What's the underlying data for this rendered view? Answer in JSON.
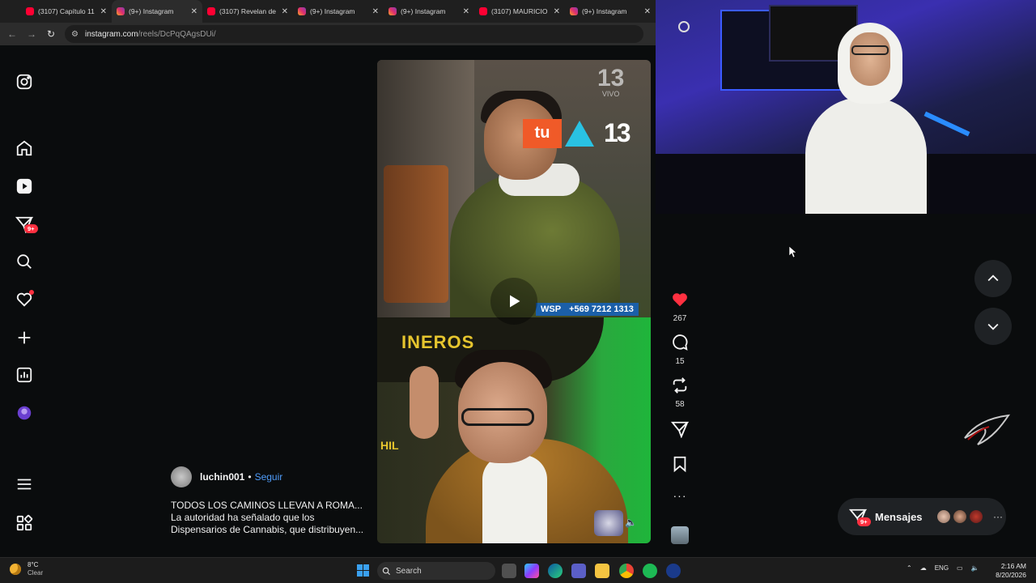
{
  "browser": {
    "tabs": [
      {
        "label": "(3107) Capítulo 11",
        "type": "youtube"
      },
      {
        "label": "(9+) Instagram",
        "type": "instagram",
        "active": true
      },
      {
        "label": "(3107) Revelan de",
        "type": "youtube"
      },
      {
        "label": "(9+) Instagram",
        "type": "instagram"
      },
      {
        "label": "(9+) Instagram",
        "type": "instagram"
      },
      {
        "label": "(3107) MAURICIO",
        "type": "youtube"
      },
      {
        "label": "(9+) Instagram",
        "type": "instagram"
      }
    ],
    "tab_close": "✕",
    "url_host": "instagram.com",
    "url_path": "/reels/DcPqQAgsDUi/"
  },
  "sidebar": {
    "notifications_badge": "9+"
  },
  "video": {
    "channel_logo": "tu",
    "channel_number": "13",
    "watermark_number": "13",
    "watermark_text": "VIVO",
    "wsp_label": "WSP",
    "wsp_phone": "+569 7212 1313",
    "banner_text": "INEROS",
    "sub_banner_text": "HIL"
  },
  "post": {
    "author": "luchin001",
    "separator": "•",
    "follow_label": "Seguir",
    "caption_lines": [
      "TODOS LOS CAMINOS LLEVAN A ROMA...",
      "La autoridad ha señalado que los",
      "Dispensarios de Cannabis, que distribuyen..."
    ]
  },
  "actions": {
    "likes": "267",
    "comments": "15",
    "reposts": "58",
    "more": "···"
  },
  "messages": {
    "label": "Mensajes",
    "badge": "9+",
    "more": "···"
  },
  "taskbar": {
    "temperature": "8°C",
    "condition": "Clear",
    "search_placeholder": "Search",
    "language": "ENG",
    "time": "2:16 AM",
    "date": "8/20/2026"
  },
  "colors": {
    "accent_blue": "#4f9cf9",
    "like_red": "#ff3040",
    "badge_red": "#ff3040"
  }
}
